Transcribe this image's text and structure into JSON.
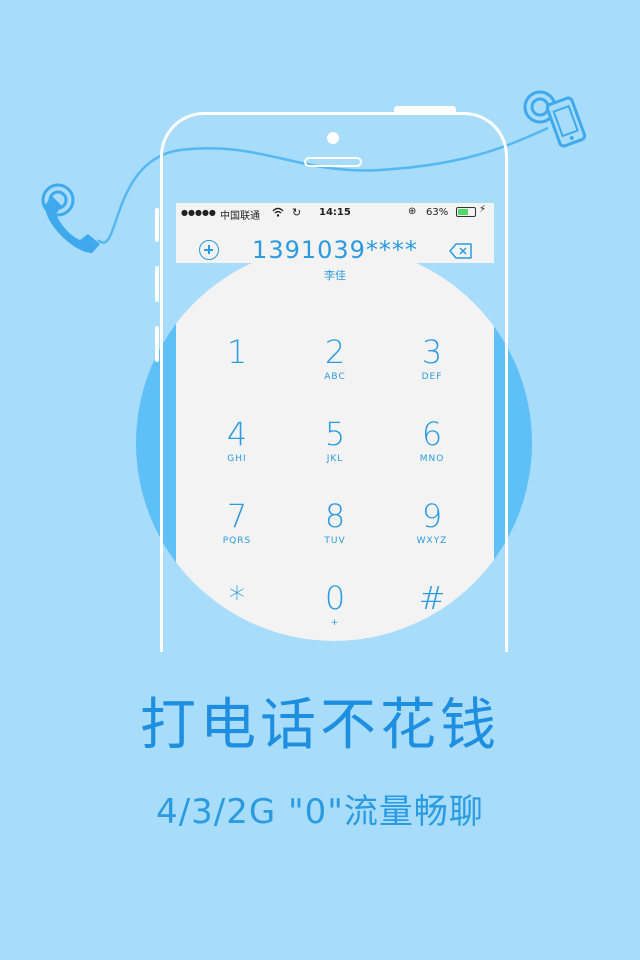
{
  "status_bar": {
    "signal": "●●●●●",
    "carrier": "中国联通",
    "time": "14:15",
    "battery_percent": "63%",
    "battery_level": 0.63
  },
  "dialer": {
    "number": "1391039****",
    "contact_name": "李佳",
    "keys": [
      {
        "digit": "1",
        "letters": ""
      },
      {
        "digit": "2",
        "letters": "ABC"
      },
      {
        "digit": "3",
        "letters": "DEF"
      },
      {
        "digit": "4",
        "letters": "GHI"
      },
      {
        "digit": "5",
        "letters": "JKL"
      },
      {
        "digit": "6",
        "letters": "MNO"
      },
      {
        "digit": "7",
        "letters": "PQRS"
      },
      {
        "digit": "8",
        "letters": "TUV"
      },
      {
        "digit": "9",
        "letters": "WXYZ"
      },
      {
        "digit": "*",
        "letters": ""
      },
      {
        "digit": "0",
        "letters": "+"
      },
      {
        "digit": "#",
        "letters": ""
      }
    ]
  },
  "promo": {
    "headline": "打电话不花钱",
    "subline": "4/3/2G \"0\"流量畅聊"
  },
  "colors": {
    "background": "#a8dcfb",
    "circle": "#5ec0f7",
    "accent": "#2a9be0",
    "headline": "#1e8fe0"
  },
  "icons": [
    "handset-icon",
    "mobile-phone-icon",
    "add-contact-icon",
    "backspace-icon",
    "wifi-icon",
    "sync-icon",
    "rotation-lock-icon",
    "battery-icon"
  ]
}
